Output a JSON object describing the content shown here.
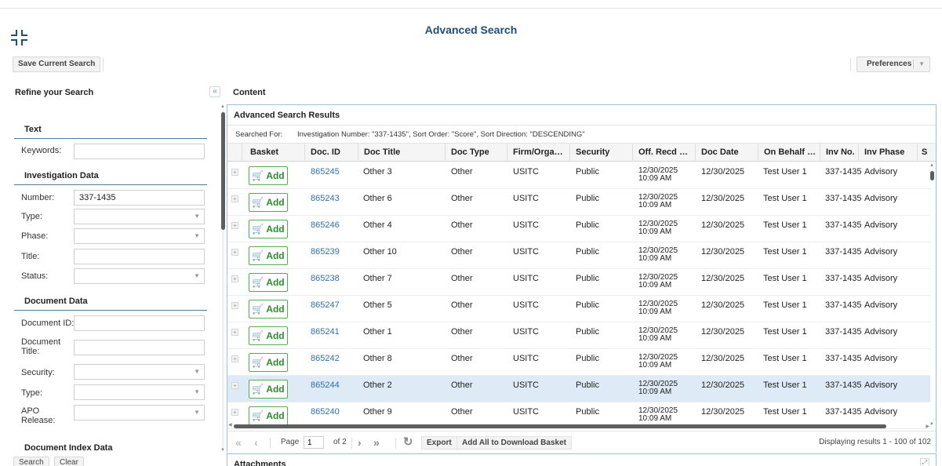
{
  "page": {
    "title": "Advanced Search",
    "collapse_icon": "collapse-arrows-icon"
  },
  "toolbar": {
    "save_label": "Save Current Search",
    "preferences_label": "Preferences"
  },
  "left_panel": {
    "title": "Refine your Search",
    "sections": {
      "text": "Text",
      "investigation": "Investigation Data",
      "document": "Document Data",
      "document_index": "Document Index Data"
    },
    "fields": {
      "keywords": {
        "label": "Keywords:",
        "value": ""
      },
      "number": {
        "label": "Number:",
        "value": "337-1435"
      },
      "inv_type": {
        "label": "Type:",
        "value": ""
      },
      "phase": {
        "label": "Phase:",
        "value": ""
      },
      "title": {
        "label": "Title:",
        "value": ""
      },
      "status": {
        "label": "Status:",
        "value": ""
      },
      "document_id": {
        "label": "Document ID:",
        "value": ""
      },
      "document_title": {
        "label": "Document Title:",
        "value": ""
      },
      "security": {
        "label": "Security:",
        "value": ""
      },
      "doc_type": {
        "label": "Type:",
        "value": ""
      },
      "apo_release": {
        "label": "APO Release:",
        "value": ""
      }
    },
    "search_label": "Search",
    "clear_label": "Clear"
  },
  "content": {
    "title": "Content",
    "results_title": "Advanced Search Results",
    "searched_for_label": "Searched For:",
    "searched_for_value": "Investigation Number: \"337-1435\", Sort Order: \"Score\", Sort Direction: \"DESCENDING\"",
    "columns": [
      "Basket",
      "Doc. ID",
      "Doc Title",
      "Doc Type",
      "Firm/Orga…",
      "Security",
      "Off. Recd …",
      "Doc Date",
      "On Behalf …",
      "Inv No.",
      "Inv Phase",
      "S"
    ],
    "add_label": "Add",
    "rows": [
      {
        "doc_id": "865245",
        "title": "Other 3",
        "type": "Other",
        "firm": "USITC",
        "security": "Public",
        "recd_date": "12/30/2025",
        "recd_time": "10:09 AM",
        "doc_date": "12/30/2025",
        "behalf": "Test User 1",
        "inv_no": "337-1435",
        "phase": "Advisory"
      },
      {
        "doc_id": "865243",
        "title": "Other 6",
        "type": "Other",
        "firm": "USITC",
        "security": "Public",
        "recd_date": "12/30/2025",
        "recd_time": "10:09 AM",
        "doc_date": "12/30/2025",
        "behalf": "Test User 1",
        "inv_no": "337-1435",
        "phase": "Advisory"
      },
      {
        "doc_id": "865246",
        "title": "Other 4",
        "type": "Other",
        "firm": "USITC",
        "security": "Public",
        "recd_date": "12/30/2025",
        "recd_time": "10:09 AM",
        "doc_date": "12/30/2025",
        "behalf": "Test User 1",
        "inv_no": "337-1435",
        "phase": "Advisory"
      },
      {
        "doc_id": "865239",
        "title": "Other 10",
        "type": "Other",
        "firm": "USITC",
        "security": "Public",
        "recd_date": "12/30/2025",
        "recd_time": "10:09 AM",
        "doc_date": "12/30/2025",
        "behalf": "Test User 1",
        "inv_no": "337-1435",
        "phase": "Advisory"
      },
      {
        "doc_id": "865238",
        "title": "Other 7",
        "type": "Other",
        "firm": "USITC",
        "security": "Public",
        "recd_date": "12/30/2025",
        "recd_time": "10:09 AM",
        "doc_date": "12/30/2025",
        "behalf": "Test User 1",
        "inv_no": "337-1435",
        "phase": "Advisory"
      },
      {
        "doc_id": "865247",
        "title": "Other 5",
        "type": "Other",
        "firm": "USITC",
        "security": "Public",
        "recd_date": "12/30/2025",
        "recd_time": "10:09 AM",
        "doc_date": "12/30/2025",
        "behalf": "Test User 1",
        "inv_no": "337-1435",
        "phase": "Advisory"
      },
      {
        "doc_id": "865241",
        "title": "Other 1",
        "type": "Other",
        "firm": "USITC",
        "security": "Public",
        "recd_date": "12/30/2025",
        "recd_time": "10:09 AM",
        "doc_date": "12/30/2025",
        "behalf": "Test User 1",
        "inv_no": "337-1435",
        "phase": "Advisory"
      },
      {
        "doc_id": "865242",
        "title": "Other 8",
        "type": "Other",
        "firm": "USITC",
        "security": "Public",
        "recd_date": "12/30/2025",
        "recd_time": "10:09 AM",
        "doc_date": "12/30/2025",
        "behalf": "Test User 1",
        "inv_no": "337-1435",
        "phase": "Advisory"
      },
      {
        "doc_id": "865244",
        "title": "Other 2",
        "type": "Other",
        "firm": "USITC",
        "security": "Public",
        "recd_date": "12/30/2025",
        "recd_time": "10:09 AM",
        "doc_date": "12/30/2025",
        "behalf": "Test User 1",
        "inv_no": "337-1435",
        "phase": "Advisory",
        "selected": true
      },
      {
        "doc_id": "865240",
        "title": "Other 9",
        "type": "Other",
        "firm": "USITC",
        "security": "Public",
        "recd_date": "12/30/2025",
        "recd_time": "10:09 AM",
        "doc_date": "12/30/2025",
        "behalf": "Test User 1",
        "inv_no": "337-1435",
        "phase": "Advisory"
      }
    ],
    "pager": {
      "page_label": "Page",
      "page_value": "1",
      "of_label": "of 2",
      "export_label": "Export",
      "add_all_label": "Add All to Download Basket",
      "displaying": "Displaying results 1 - 100 of 102"
    },
    "attachments_title": "Attachments"
  },
  "colors": {
    "title": "#1f4e7a",
    "link": "#2f6fa8",
    "add_green": "#2e8b2e",
    "panel_border": "#9ec0dc",
    "selected_row": "#deebf6"
  }
}
